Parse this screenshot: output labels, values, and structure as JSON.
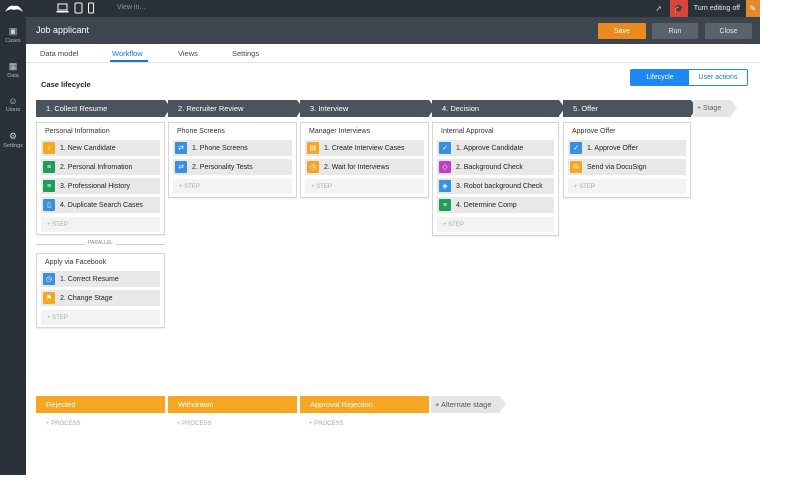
{
  "topbar": {
    "view_in": "View in...",
    "turn_editing_off": "Turn editing off",
    "icons": [
      "laptop-icon",
      "tablet-icon",
      "phone-icon",
      "pointer-icon",
      "graduation-cap-icon",
      "pencil-icon"
    ]
  },
  "sidebar": {
    "items": [
      {
        "label": "Cases",
        "icon": "cases-icon"
      },
      {
        "label": "Data",
        "icon": "data-icon"
      },
      {
        "label": "Users",
        "icon": "users-icon"
      },
      {
        "label": "Settings",
        "icon": "gear-icon"
      }
    ]
  },
  "header": {
    "title": "Job applicant",
    "save": "Save",
    "run": "Run",
    "close": "Close"
  },
  "tabs": [
    "Data model",
    "Workflow",
    "Views",
    "Settings"
  ],
  "active_tab": "Workflow",
  "section_title": "Case lifecycle",
  "toggle": {
    "lifecycle": "Lifecycle",
    "user_actions": "User actions"
  },
  "stages": [
    "1. Collect Resume",
    "2. Recruiter Review",
    "3. Interview",
    "4. Decision",
    "5. Offer"
  ],
  "add_stage": "+ Stage",
  "processes": {
    "personal_information": {
      "title": "Personal Information",
      "steps": [
        "1. New Candidate",
        "2. Personal Infromation",
        "3. Professional History",
        "4. Duplicate Search Cases"
      ],
      "add_step": "+ STEP"
    },
    "parallel": "PARALLEL",
    "apply_facebook": {
      "title": "Apply via Facebook",
      "steps": [
        "1. Correct Resume",
        "2. Change Stage"
      ],
      "add_step": "+ STEP"
    },
    "phone_screens": {
      "title": "Phone Screens",
      "steps": [
        "1. Phone Screens",
        "2. Personality Tests"
      ],
      "add_step": "+ STEP"
    },
    "manager_interviews": {
      "title": "Manager Interviews",
      "steps": [
        "1. Create Interview Cases",
        "2. Wait for Interviews"
      ],
      "add_step": "+ STEP"
    },
    "internal_approval": {
      "title": "Internal Approval",
      "steps": [
        "1. Approve Candidate",
        "2. Background Check",
        "3. Robot background Check",
        "4. Determine Comp"
      ],
      "add_step": "+ STEP"
    },
    "approve_offer": {
      "title": "Approve Offer",
      "steps": [
        "1. Approve Offer",
        "Send via DocuSign"
      ],
      "add_step": "+ STEP"
    }
  },
  "alternate_stages": [
    "Rejected",
    "Withdrawn",
    "Approval Rejection"
  ],
  "add_alternate": "+ Alternate stage",
  "add_process": "+ PROCESS",
  "colors": {
    "topbar": "#2a3139",
    "header": "#3d454f",
    "stage": "#4b535d",
    "alt_stage": "#f5a623",
    "accent_blue": "#1e87f0",
    "save_orange": "#e98c1d"
  }
}
